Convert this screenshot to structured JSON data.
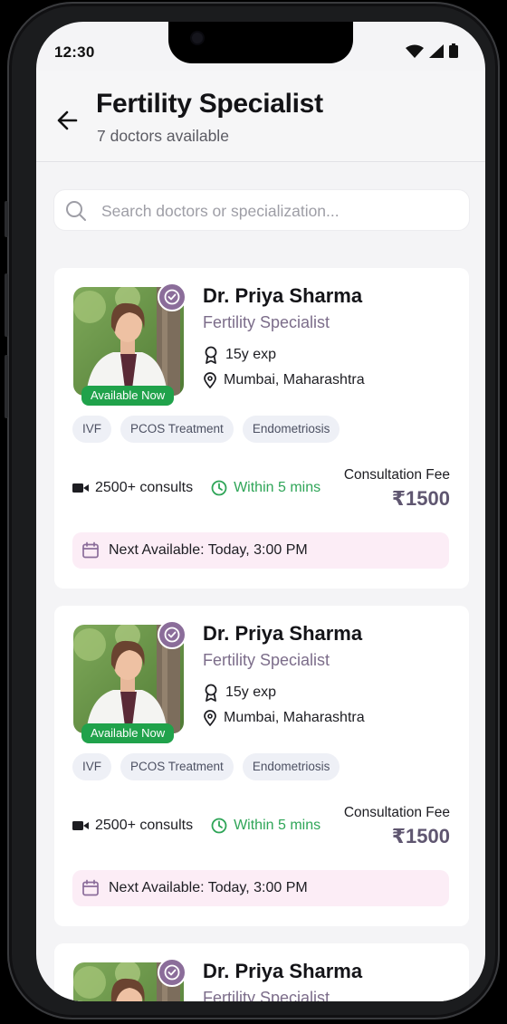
{
  "status": {
    "time": "12:30"
  },
  "header": {
    "title": "Fertility Specialist",
    "subtitle": "7 doctors available"
  },
  "search": {
    "placeholder": "Search doctors or specialization..."
  },
  "icons": {
    "back": "arrow-left-icon",
    "search": "search-icon",
    "verified": "verified-check-icon",
    "experience": "award-icon",
    "location": "map-pin-icon",
    "video": "video-icon",
    "clock": "clock-icon",
    "calendar": "calendar-icon"
  },
  "colors": {
    "accent": "#8b6d9a",
    "available": "#20a24b",
    "response": "#2fa558",
    "fee": "#5f5670",
    "next_bg": "#fcedf6"
  },
  "doctors": [
    {
      "name": "Dr. Priya Sharma",
      "specialty": "Fertility Specialist",
      "available_badge": "Available Now",
      "experience": "15y exp",
      "location": "Mumbai, Maharashtra",
      "tags": [
        "IVF",
        "PCOS Treatment",
        "Endometriosis"
      ],
      "consults": "2500+ consults",
      "response": "Within 5 mins",
      "fee_label": "Consultation Fee",
      "fee": "₹1500",
      "next_available": "Next Available: Today, 3:00 PM"
    },
    {
      "name": "Dr. Priya Sharma",
      "specialty": "Fertility Specialist",
      "available_badge": "Available Now",
      "experience": "15y exp",
      "location": "Mumbai, Maharashtra",
      "tags": [
        "IVF",
        "PCOS Treatment",
        "Endometriosis"
      ],
      "consults": "2500+ consults",
      "response": "Within 5 mins",
      "fee_label": "Consultation Fee",
      "fee": "₹1500",
      "next_available": "Next Available: Today, 3:00 PM"
    },
    {
      "name": "Dr. Priya Sharma",
      "specialty": "Fertility Specialist"
    }
  ]
}
